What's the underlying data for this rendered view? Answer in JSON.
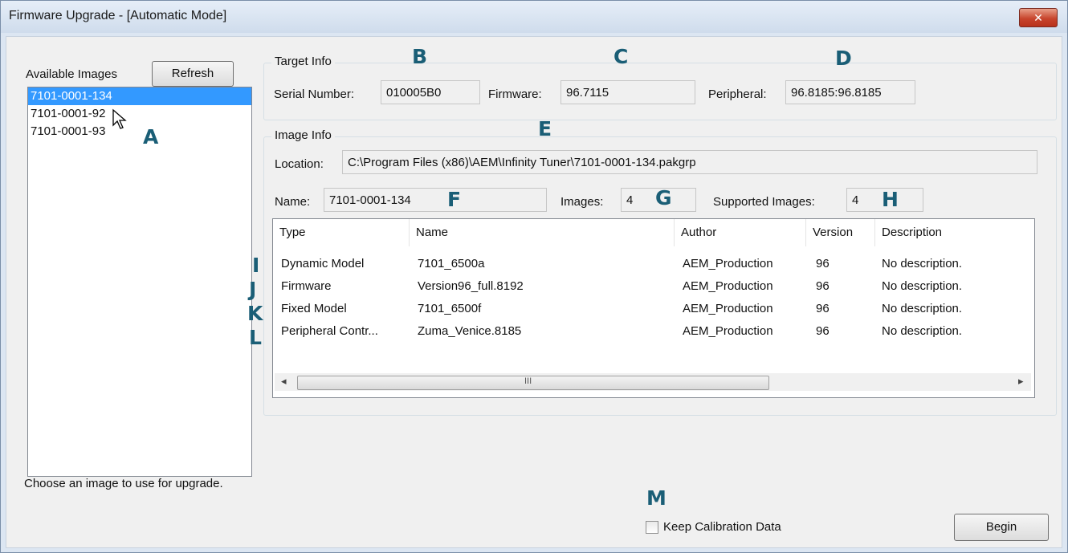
{
  "window": {
    "title": "Firmware Upgrade - [Automatic Mode]",
    "close_glyph": "✕"
  },
  "left": {
    "available_label": "Available Images",
    "refresh_label": "Refresh",
    "images": [
      "7101-0001-134",
      "7101-0001-92",
      "7101-0001-93"
    ],
    "selected_index": 0,
    "hint": "Choose an image to use for upgrade."
  },
  "target": {
    "group_label": "Target Info",
    "serial_label": "Serial Number:",
    "serial_value": "010005B0",
    "firmware_label": "Firmware:",
    "firmware_value": "96.7115",
    "peripheral_label": "Peripheral:",
    "peripheral_value": "96.8185:96.8185"
  },
  "image": {
    "group_label": "Image Info",
    "location_label": "Location:",
    "location_value": "C:\\Program Files (x86)\\AEM\\Infinity Tuner\\7101-0001-134.pakgrp",
    "name_label": "Name:",
    "name_value": "7101-0001-134",
    "images_label": "Images:",
    "images_value": "4",
    "supported_label": "Supported Images:",
    "supported_value": "4"
  },
  "table": {
    "columns": [
      "Type",
      "Name",
      "Author",
      "Version",
      "Description"
    ],
    "rows": [
      [
        "Dynamic Model",
        "7101_6500a",
        "AEM_Production",
        "96",
        "No description."
      ],
      [
        "Firmware",
        "Version96_full.8192",
        "AEM_Production",
        "96",
        "No description."
      ],
      [
        "Fixed Model",
        "7101_6500f",
        "AEM_Production",
        "96",
        "No description."
      ],
      [
        "Peripheral Contr...",
        "Zuma_Venice.8185",
        "AEM_Production",
        "96",
        "No description."
      ]
    ],
    "scroll_grip": "III",
    "scroll_left": "◂",
    "scroll_right": "▸"
  },
  "footer": {
    "keep_calibration_label": "Keep Calibration Data",
    "keep_calibration_checked": false,
    "begin_label": "Begin"
  },
  "callouts": {
    "A": "A",
    "B": "B",
    "C": "C",
    "D": "D",
    "E": "E",
    "F": "F",
    "G": "G",
    "H": "H",
    "I": "I",
    "J": "J",
    "K": "K",
    "L": "L",
    "M": "M"
  },
  "colors": {
    "selection": "#3399ff",
    "callout": "#1a5e76",
    "close_button": "#c8452d"
  }
}
